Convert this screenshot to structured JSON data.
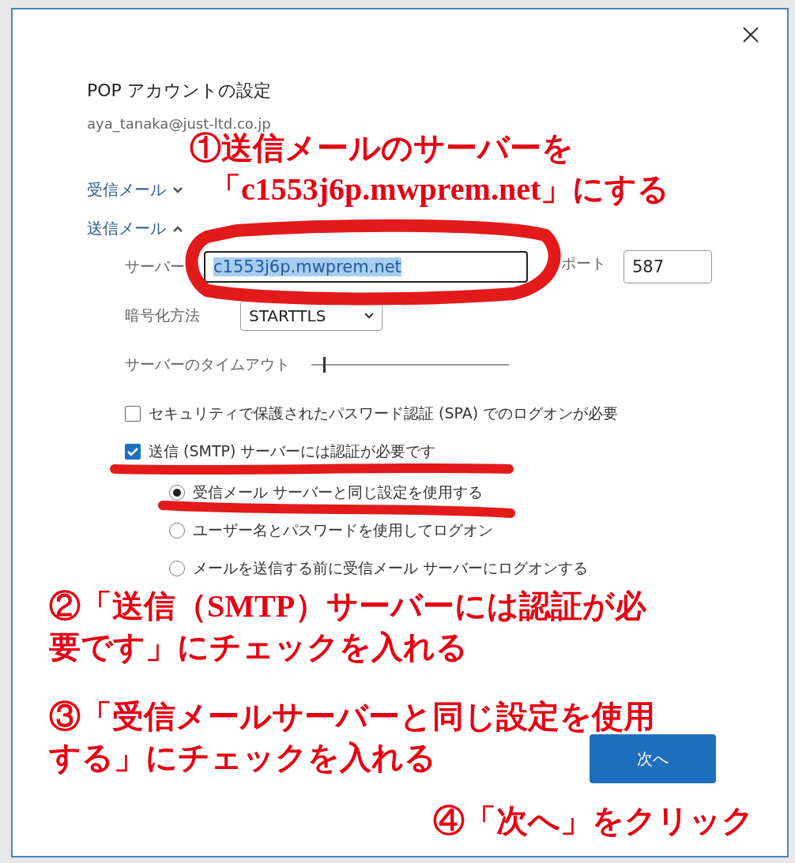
{
  "dialog": {
    "title": "POP アカウントの設定",
    "email": "aya_tanaka@just-ltd.co.jp",
    "sections": [
      {
        "label": "受信メール",
        "expanded": false
      },
      {
        "label": "送信メール",
        "expanded": true
      }
    ],
    "server": {
      "label": "サーバー",
      "value": "c1553j6p.mwprem.net",
      "port_label": "ポート",
      "port": "587"
    },
    "encryption": {
      "label": "暗号化方法",
      "value": "STARTTLS"
    },
    "timeout": {
      "label": "サーバーのタイムアウト",
      "level": 0.06
    },
    "checkboxes": [
      {
        "label": "セキュリティで保護されたパスワード認証 (SPA) でのログオンが必要",
        "checked": false
      },
      {
        "label": "送信 (SMTP) サーバーには認証が必要です",
        "checked": true
      }
    ],
    "radios": [
      {
        "label": "受信メール サーバーと同じ設定を使用する",
        "selected": true
      },
      {
        "label": "ユーザー名とパスワードを使用してログオン",
        "selected": false
      },
      {
        "label": "メールを送信する前に受信メール サーバーにログオンする",
        "selected": false
      }
    ],
    "next_button": "次へ"
  },
  "annotations": [
    {
      "lines": [
        "①送信メールのサーバーを",
        "「c1553j6p.mwprem.net」にする"
      ]
    },
    {
      "lines": [
        "②「送信（SMTP）サーバーには認証が必",
        "要です」にチェックを入れる"
      ]
    },
    {
      "lines": [
        "③「受信メールサーバーと同じ設定を使用",
        "する」にチェックを入れる"
      ]
    },
    {
      "lines": [
        "④「次へ」をクリック"
      ]
    }
  ]
}
